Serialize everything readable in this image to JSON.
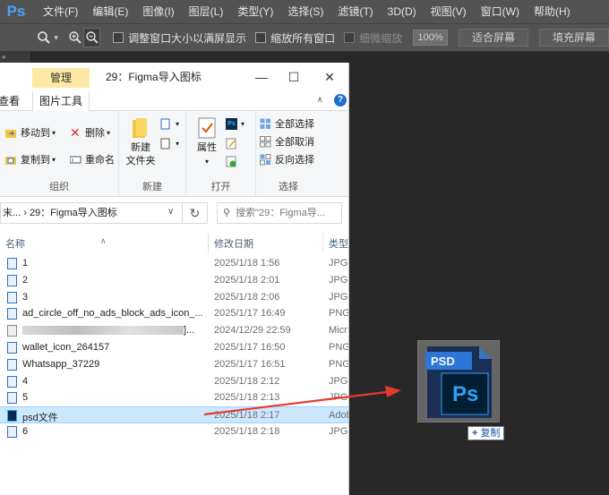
{
  "photoshop": {
    "logo": "Ps",
    "menu": [
      "文件(F)",
      "编辑(E)",
      "图像(I)",
      "图层(L)",
      "类型(Y)",
      "选择(S)",
      "滤镜(T)",
      "3D(D)",
      "视图(V)",
      "窗口(W)",
      "帮助(H)"
    ],
    "options": {
      "resize_windows": "调整窗口大小以满屏显示",
      "zoom_all_windows": "缩放所有窗口",
      "scrubby_zoom": "细微缩放",
      "zoom_value": "100%",
      "fit_screen": "适合屏幕",
      "fill_screen": "填充屏幕"
    },
    "panel_toggle": "»",
    "drag_preview": {
      "file_badge": "PSD",
      "app_badge": "Ps",
      "copy_tooltip": "复制",
      "copy_symbol": "+"
    }
  },
  "explorer": {
    "context_tab": "管理",
    "title": "29：Figma导入图标",
    "title_controls": [
      "—",
      "☐",
      "✕"
    ],
    "tabs": {
      "view": "查看",
      "picture_tools": "图片工具"
    },
    "ribbon": {
      "organize": {
        "label": "组织",
        "move_to": "移动到",
        "delete": "删除",
        "copy_to": "复制到",
        "rename": "重命名"
      },
      "new": {
        "label": "新建",
        "new_folder": "新建\n文件夹"
      },
      "open": {
        "label": "打开",
        "properties": "属性"
      },
      "select": {
        "label": "选择",
        "select_all": "全部选择",
        "select_none": "全部取消",
        "invert": "反向选择"
      }
    },
    "address": {
      "path": "末...  ›  29：Figma导入图标",
      "search_placeholder": "搜索\"29：Figma导..."
    },
    "columns": {
      "name": "名称",
      "modified": "修改日期",
      "type": "类型"
    },
    "files": [
      {
        "name": "1",
        "modified": "2025/1/18 1:56",
        "type": "JPG"
      },
      {
        "name": "2",
        "modified": "2025/1/18 2:01",
        "type": "JPG"
      },
      {
        "name": "3",
        "modified": "2025/1/18 2:06",
        "type": "JPG"
      },
      {
        "name": "ad_circle_off_no_ads_block_ads_icon_...",
        "modified": "2025/1/17 16:49",
        "type": "PNG"
      },
      {
        "name": "]...",
        "modified": "2024/12/29 22:59",
        "type": "Micr"
      },
      {
        "name": "wallet_icon_264157",
        "modified": "2025/1/17 16:50",
        "type": "PNG"
      },
      {
        "name": "Whatsapp_37229",
        "modified": "2025/1/17 16:51",
        "type": "PNG"
      },
      {
        "name": "4",
        "modified": "2025/1/18 2:12",
        "type": "JPG"
      },
      {
        "name": "5",
        "modified": "2025/1/18 2:13",
        "type": "JPG"
      },
      {
        "name": "psd文件",
        "modified": "2025/1/18 2:17",
        "type": "Adob"
      },
      {
        "name": "6",
        "modified": "2025/1/18 2:18",
        "type": "JPG"
      }
    ]
  }
}
